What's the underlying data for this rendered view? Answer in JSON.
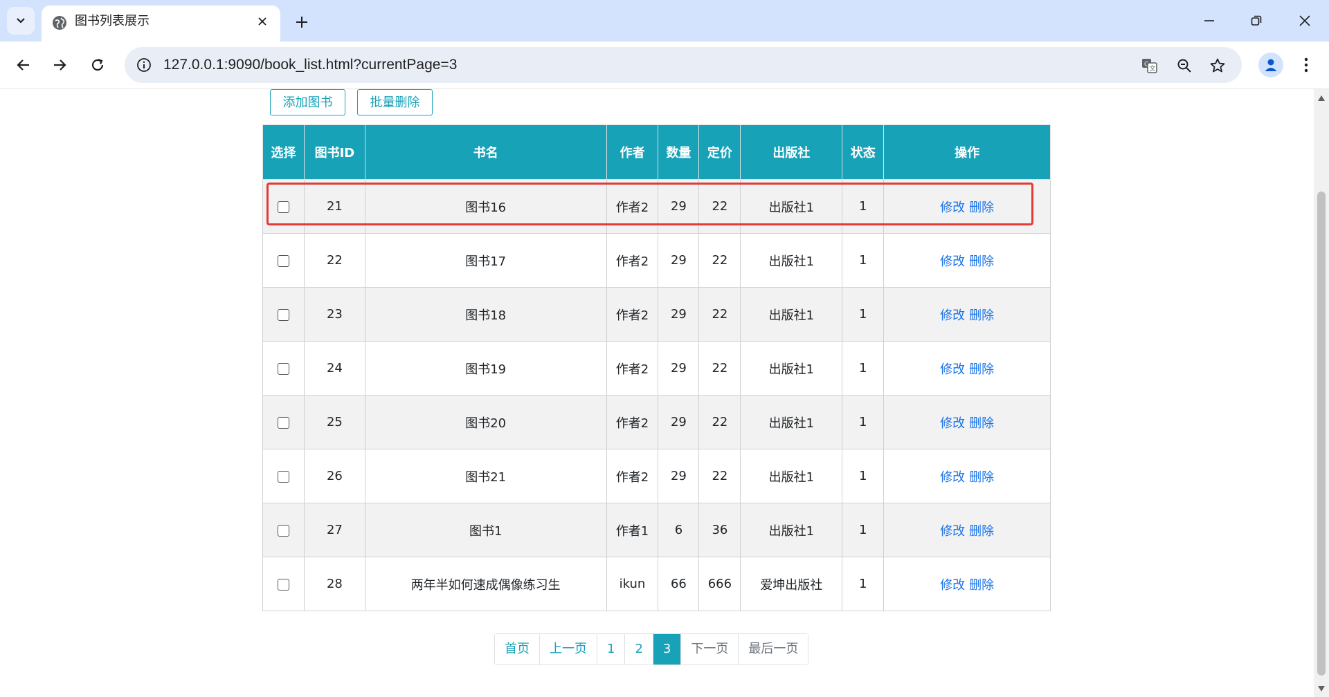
{
  "browser": {
    "tab_title": "图书列表展示",
    "url": "127.0.0.1:9090/book_list.html?currentPage=3"
  },
  "icons": {
    "tab_list": "chevron-down-icon",
    "favicon": "globe-icon",
    "tab_close": "close-icon",
    "new_tab": "plus-icon",
    "minimize": "minimize-icon",
    "restore": "restore-icon",
    "close_window": "close-icon",
    "back": "back-arrow-icon",
    "forward": "forward-arrow-icon",
    "reload": "reload-icon",
    "site_info": "info-icon",
    "translate": "translate-icon",
    "zoom": "zoom-icon",
    "bookmark": "star-icon",
    "profile": "person-icon",
    "menu": "more-vertical-icon"
  },
  "colors": {
    "accent": "#17a2b8",
    "link": "#1a73e8",
    "highlight": "#e53935"
  },
  "actions": {
    "add_label": "添加图书",
    "batch_delete_label": "批量删除"
  },
  "table": {
    "headers": [
      "选择",
      "图书ID",
      "书名",
      "作者",
      "数量",
      "定价",
      "出版社",
      "状态",
      "操作"
    ],
    "edit_label": "修改",
    "delete_label": "删除",
    "rows": [
      {
        "id": "21",
        "name": "图书16",
        "author": "作者2",
        "count": "29",
        "price": "22",
        "publisher": "出版社1",
        "status": "1"
      },
      {
        "id": "22",
        "name": "图书17",
        "author": "作者2",
        "count": "29",
        "price": "22",
        "publisher": "出版社1",
        "status": "1"
      },
      {
        "id": "23",
        "name": "图书18",
        "author": "作者2",
        "count": "29",
        "price": "22",
        "publisher": "出版社1",
        "status": "1"
      },
      {
        "id": "24",
        "name": "图书19",
        "author": "作者2",
        "count": "29",
        "price": "22",
        "publisher": "出版社1",
        "status": "1"
      },
      {
        "id": "25",
        "name": "图书20",
        "author": "作者2",
        "count": "29",
        "price": "22",
        "publisher": "出版社1",
        "status": "1"
      },
      {
        "id": "26",
        "name": "图书21",
        "author": "作者2",
        "count": "29",
        "price": "22",
        "publisher": "出版社1",
        "status": "1"
      },
      {
        "id": "27",
        "name": "图书1",
        "author": "作者1",
        "count": "6",
        "price": "36",
        "publisher": "出版社1",
        "status": "1"
      },
      {
        "id": "28",
        "name": "两年半如何速成偶像练习生",
        "author": "ikun",
        "count": "66",
        "price": "666",
        "publisher": "爱坤出版社",
        "status": "1"
      }
    ]
  },
  "pagination": {
    "first": "首页",
    "prev": "上一页",
    "pages": [
      "1",
      "2",
      "3"
    ],
    "current": "3",
    "next": "下一页",
    "last": "最后一页"
  }
}
